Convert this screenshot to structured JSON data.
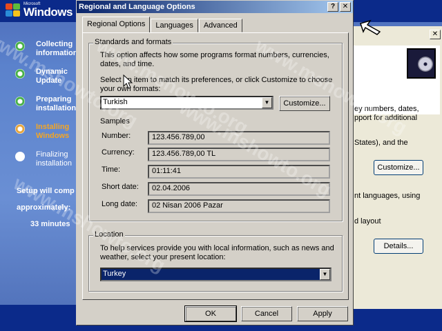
{
  "setup": {
    "logo_small": "Microsoft",
    "logo": "Windows",
    "steps": [
      {
        "label": "Collecting\ninformation",
        "state": "done"
      },
      {
        "label": "Dynamic\nUpdate",
        "state": "done"
      },
      {
        "label": "Preparing\ninstallation",
        "state": "done"
      },
      {
        "label": "Installing\nWindows",
        "state": "active"
      },
      {
        "label": "Finalizing\ninstallation",
        "state": "pending"
      }
    ],
    "time_line1": "Setup will comp",
    "time_line2": "approximately:",
    "time_line3": "33 minutes"
  },
  "back_window": {
    "text1": "ey numbers, dates,",
    "text2": "pport for additional",
    "text3": "States), and the",
    "customize_label": "Customize...",
    "text4": "nt languages, using",
    "text5": "d layout",
    "details_label": "Details..."
  },
  "dialog": {
    "title": "Regional and Language Options",
    "help_btn": "?",
    "close_btn": "✕",
    "tabs": [
      "Regional Options",
      "Languages",
      "Advanced"
    ],
    "standards": {
      "title": "Standards and formats",
      "desc": "This option affects how some programs format numbers, currencies, dates, and time.",
      "select_text": "Select an item to match its preferences, or click Customize to choose your own formats:",
      "selected_format": "Turkish",
      "customize_label": "Customize...",
      "samples_title": "Samples",
      "samples": [
        {
          "label": "Number:",
          "value": "123.456.789,00"
        },
        {
          "label": "Currency:",
          "value": "123.456.789,00 TL"
        },
        {
          "label": "Time:",
          "value": "01:11:41"
        },
        {
          "label": "Short date:",
          "value": "02.04.2006"
        },
        {
          "label": "Long date:",
          "value": "02 Nisan 2006 Pazar"
        }
      ]
    },
    "location": {
      "title": "Location",
      "desc": "To help services provide you with local information, such as news and weather, select your present location:",
      "selected": "Turkey"
    },
    "buttons": {
      "ok": "OK",
      "cancel": "Cancel",
      "apply": "Apply"
    }
  },
  "watermark": "www.mshowto.org",
  "colors": {
    "title_start": "#0a246a",
    "title_end": "#a6caf0",
    "dialog_bg": "#d4d0c8",
    "setup_active": "#f5a623"
  }
}
